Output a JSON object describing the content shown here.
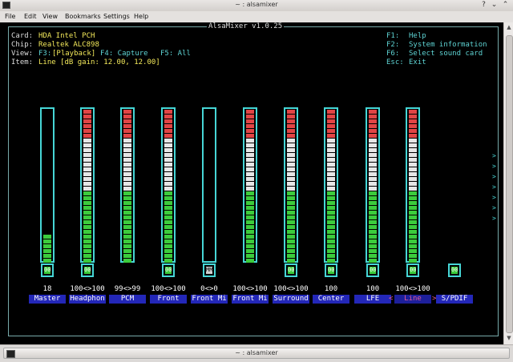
{
  "window": {
    "title": "~ : alsamixer"
  },
  "menubar": {
    "items": [
      "File",
      "Edit",
      "View",
      "Bookmarks",
      "Settings",
      "Help"
    ]
  },
  "mixer": {
    "version_title": "AlsaMixer v1.0.25",
    "info": {
      "card_label": "Card:",
      "card_value": "HDA Intel PCH",
      "chip_label": "Chip:",
      "chip_value": "Realtek ALC898",
      "view_label": "View:",
      "view_f3": "F3:",
      "view_playback": "[Playback]",
      "view_f4": "F4: Capture",
      "view_f5": "F5: All",
      "item_label": "Item:",
      "item_value": "Line [dB gain: 12.00, 12.00]"
    },
    "help": [
      {
        "key": "F1:",
        "desc": "Help"
      },
      {
        "key": "F2:",
        "desc": "System information"
      },
      {
        "key": "F6:",
        "desc": "Select sound card"
      },
      {
        "key": "Esc:",
        "desc": "Exit"
      }
    ],
    "channels": [
      {
        "name": "Master",
        "volume": "18",
        "level": 0.18,
        "mute": "00",
        "muted": false,
        "has_slider": true
      },
      {
        "name": "Headphon",
        "volume": "100<>100",
        "level": 1.0,
        "mute": "00",
        "muted": false,
        "has_slider": true
      },
      {
        "name": "PCM",
        "volume": "99<>99",
        "level": 1.0,
        "mute": "",
        "muted": false,
        "has_slider": true
      },
      {
        "name": "Front",
        "volume": "100<>100",
        "level": 1.0,
        "mute": "00",
        "muted": false,
        "has_slider": true
      },
      {
        "name": "Front Mi",
        "volume": "0<>0",
        "level": 0.0,
        "mute": "MM",
        "muted": true,
        "has_slider": true
      },
      {
        "name": "Front Mi",
        "volume": "100<>100",
        "level": 1.0,
        "mute": "",
        "muted": false,
        "has_slider": true
      },
      {
        "name": "Surround",
        "volume": "100<>100",
        "level": 1.0,
        "mute": "00",
        "muted": false,
        "has_slider": true
      },
      {
        "name": "Center",
        "volume": "100",
        "level": 1.0,
        "mute": "00",
        "muted": false,
        "has_slider": true
      },
      {
        "name": "LFE",
        "volume": "100",
        "level": 1.0,
        "mute": "00",
        "muted": false,
        "has_slider": true
      },
      {
        "name": "Line",
        "volume": "100<>100",
        "level": 1.0,
        "mute": "00",
        "muted": false,
        "has_slider": true,
        "selected": true
      },
      {
        "name": "S/PDIF",
        "volume": "",
        "level": 0.0,
        "mute": "00",
        "muted": false,
        "has_slider": false
      }
    ],
    "scroll_arrow": ">",
    "sel_left": "<",
    "sel_right": ">"
  },
  "taskbar": {
    "title": "~ : alsamixer"
  },
  "colors": {
    "frame": "#46d6d6",
    "green": "#3ccc3c",
    "red": "#e14545",
    "white": "#e6e6e6",
    "label_bg": "#2327b8"
  }
}
